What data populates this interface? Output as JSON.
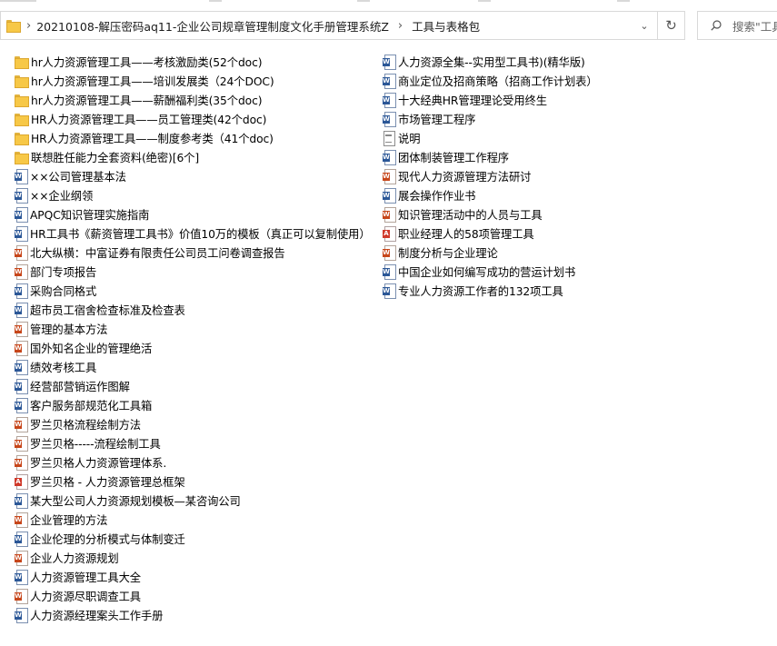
{
  "address": {
    "path_folder": "20210108-解压密码aq11-企业公司规章管理制度文化手册管理系统Z",
    "current_folder": "工具与表格包",
    "dropdown_glyph": "⌄",
    "refresh_glyph": "↻",
    "separator": "›"
  },
  "search": {
    "placeholder": "搜索\"工具"
  },
  "colors": {
    "folder": "#f7c847",
    "word": "#2b5797",
    "doc": "#c7461a",
    "pdf": "#d03a2b"
  },
  "files_col1": [
    {
      "icon": "folder",
      "name": "hr人力资源管理工具——考核激励类(52个doc)"
    },
    {
      "icon": "folder",
      "name": "hr人力资源管理工具——培训发展类（24个DOC)"
    },
    {
      "icon": "folder",
      "name": "hr人力资源管理工具——薪酬福利类(35个doc)"
    },
    {
      "icon": "folder",
      "name": "HR人力资源管理工具——员工管理类(42个doc)"
    },
    {
      "icon": "folder",
      "name": "HR人力资源管理工具——制度参考类（41个doc)"
    },
    {
      "icon": "folder",
      "name": "联想胜任能力全套资料(绝密)[6个]"
    },
    {
      "icon": "word",
      "name": "××公司管理基本法"
    },
    {
      "icon": "word",
      "name": "××企业纲领"
    },
    {
      "icon": "word",
      "name": "APQC知识管理实施指南"
    },
    {
      "icon": "word",
      "name": "HR工具书《薪资管理工具书》价值10万的模板（真正可以复制使用）"
    },
    {
      "icon": "doc",
      "name": "北大纵横：中富证券有限责任公司员工问卷调查报告"
    },
    {
      "icon": "doc",
      "name": "部门专项报告"
    },
    {
      "icon": "word",
      "name": "采购合同格式"
    },
    {
      "icon": "word",
      "name": "超市员工宿舍检查标准及检查表"
    },
    {
      "icon": "doc",
      "name": "管理的基本方法"
    },
    {
      "icon": "doc",
      "name": "国外知名企业的管理绝活"
    },
    {
      "icon": "word",
      "name": "绩效考核工具"
    },
    {
      "icon": "word",
      "name": "经营部营销运作图解"
    },
    {
      "icon": "word",
      "name": "客户服务部规范化工具箱"
    },
    {
      "icon": "doc",
      "name": "罗兰贝格流程绘制方法"
    },
    {
      "icon": "doc",
      "name": "罗兰贝格-----流程绘制工具"
    },
    {
      "icon": "doc",
      "name": "罗兰贝格人力资源管理体系."
    },
    {
      "icon": "pdf",
      "name": "罗兰贝格 - 人力资源管理总框架"
    },
    {
      "icon": "word",
      "name": "某大型公司人力资源规划模板—某咨询公司"
    },
    {
      "icon": "doc",
      "name": "企业管理的方法"
    },
    {
      "icon": "word",
      "name": "企业伦理的分析模式与体制变迁"
    },
    {
      "icon": "doc",
      "name": "企业人力资源规划"
    },
    {
      "icon": "word",
      "name": "人力资源管理工具大全"
    },
    {
      "icon": "doc",
      "name": "人力资源尽职调查工具"
    },
    {
      "icon": "word",
      "name": "人力资源经理案头工作手册"
    }
  ],
  "files_col2": [
    {
      "icon": "word",
      "name": "人力资源全集--实用型工具书)(精华版)"
    },
    {
      "icon": "word",
      "name": "商业定位及招商策略（招商工作计划表）"
    },
    {
      "icon": "word",
      "name": "十大经典HR管理理论受用终生"
    },
    {
      "icon": "word",
      "name": "市场管理工程序"
    },
    {
      "icon": "txt",
      "name": "说明"
    },
    {
      "icon": "word",
      "name": "团体制装管理工作程序"
    },
    {
      "icon": "doc",
      "name": "现代人力资源管理方法研讨"
    },
    {
      "icon": "word",
      "name": "展会操作作业书"
    },
    {
      "icon": "doc",
      "name": "知识管理活动中的人员与工具"
    },
    {
      "icon": "pdf",
      "name": "职业经理人的58项管理工具"
    },
    {
      "icon": "doc",
      "name": "制度分析与企业理论"
    },
    {
      "icon": "word",
      "name": "中国企业如何编写成功的营运计划书"
    },
    {
      "icon": "word",
      "name": "专业人力资源工作者的132项工具"
    }
  ]
}
